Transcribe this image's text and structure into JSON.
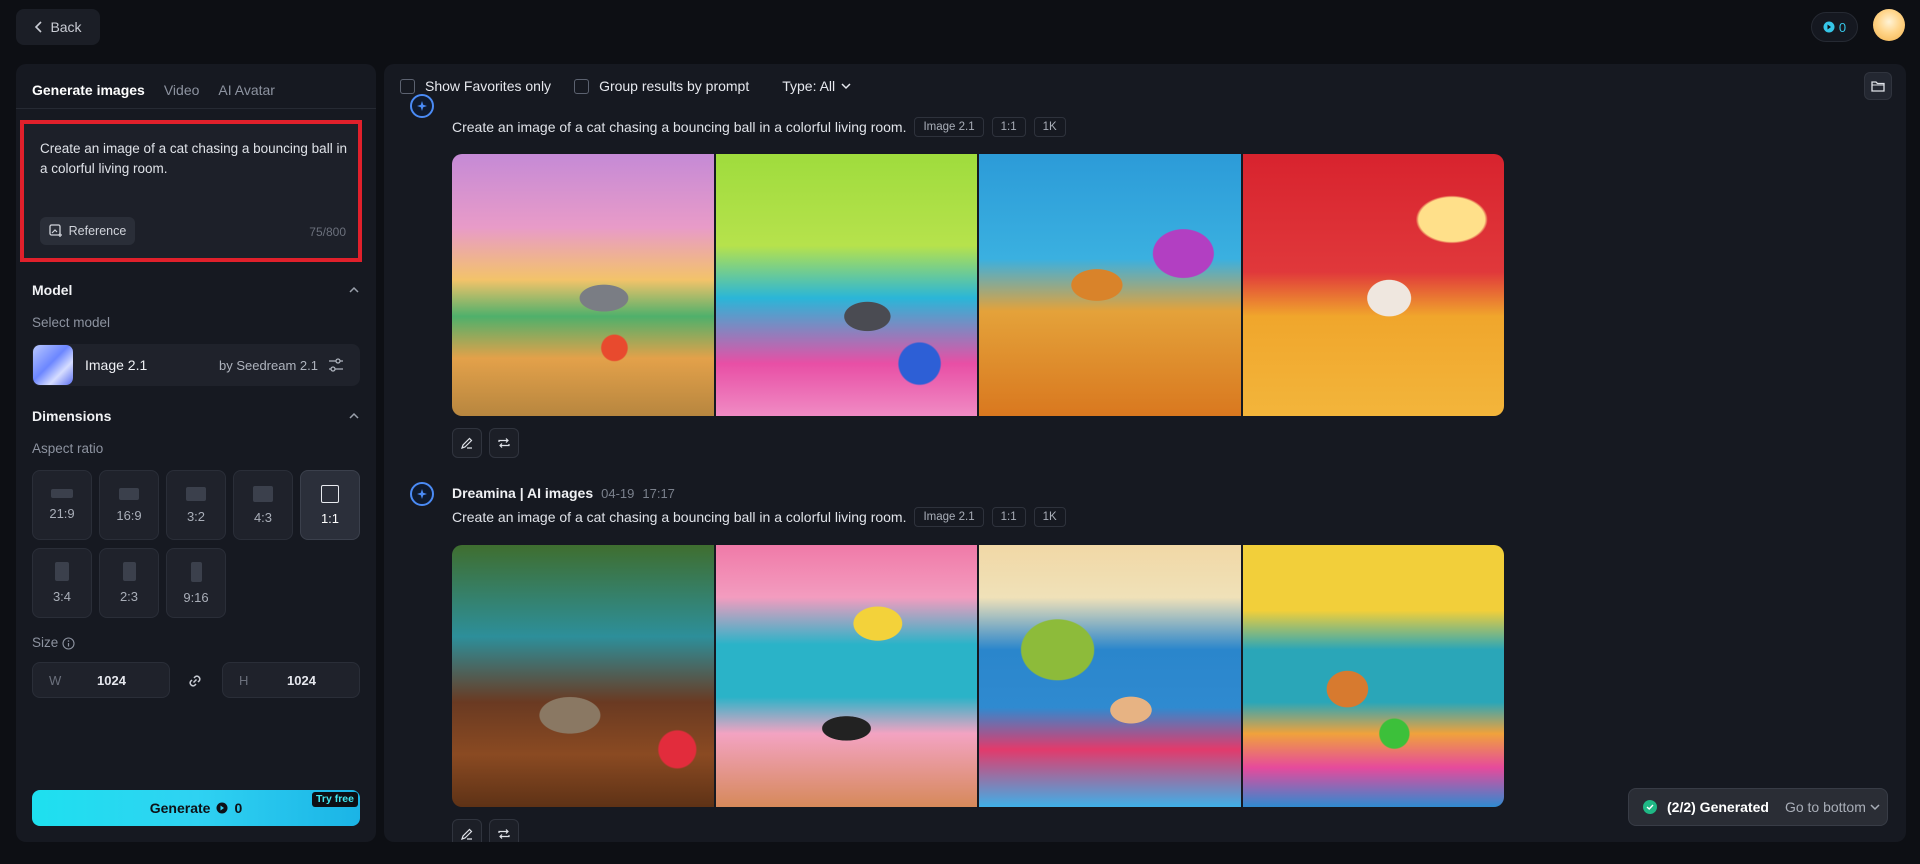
{
  "topbar": {
    "back_label": "Back",
    "credits": "0"
  },
  "sidebar": {
    "tabs": [
      {
        "label": "Generate images",
        "active": true
      },
      {
        "label": "Video",
        "active": false
      },
      {
        "label": "AI Avatar",
        "active": false
      }
    ],
    "prompt": {
      "text": "Create an image of a cat chasing a bouncing ball in a colorful living room.",
      "reference_label": "Reference",
      "char_count": "75/800"
    },
    "model": {
      "section_title": "Model",
      "select_label": "Select model",
      "name": "Image 2.1",
      "provider": "by Seedream 2.1"
    },
    "dimensions": {
      "section_title": "Dimensions",
      "aspect_label": "Aspect ratio",
      "ratios": [
        "21:9",
        "16:9",
        "3:2",
        "4:3",
        "1:1",
        "3:4",
        "2:3",
        "9:16"
      ],
      "selected_ratio": "1:1",
      "size_label": "Size",
      "width_label": "W",
      "width": "1024",
      "height_label": "H",
      "height": "1024"
    },
    "generate": {
      "label": "Generate",
      "cost": "0",
      "try_free": "Try free"
    }
  },
  "filters": {
    "favorites_label": "Show Favorites only",
    "group_label": "Group results by prompt",
    "type_label": "Type: All"
  },
  "feed": [
    {
      "prompt": "Create an image of a cat chasing a bouncing ball in a colorful living room.",
      "model_chip": "Image 2.1",
      "ratio_chip": "1:1",
      "res_chip": "1K"
    },
    {
      "author": "Dreamina | AI images",
      "date": "04-19",
      "time": "17:17",
      "prompt": "Create an image of a cat chasing a bouncing ball in a colorful living room.",
      "model_chip": "Image 2.1",
      "ratio_chip": "1:1",
      "res_chip": "1K"
    }
  ],
  "toast": {
    "status": "(2/2) Generated",
    "link": "Go to bottom"
  },
  "colors": {
    "accent": "#2fd2f2",
    "highlight_border": "#e0202b",
    "success": "#1fb885"
  }
}
